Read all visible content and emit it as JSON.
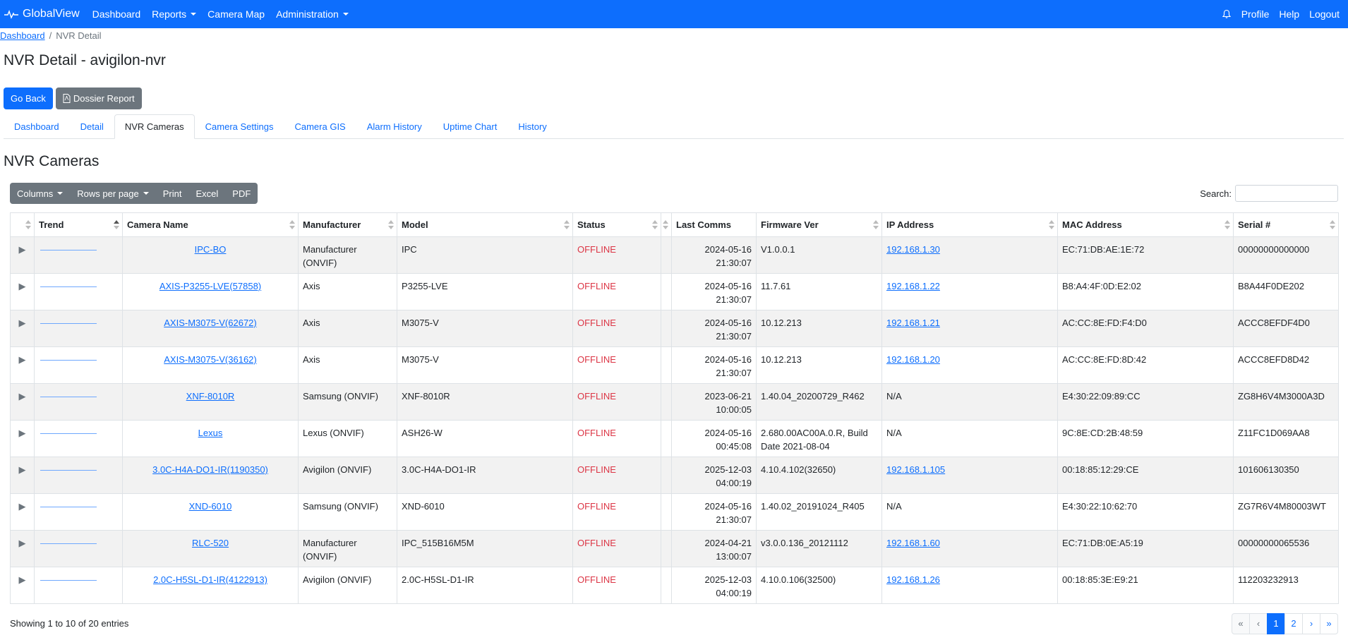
{
  "navbar": {
    "brand": "GlobalView",
    "left_items": [
      "Dashboard",
      "Reports",
      "Camera Map",
      "Administration"
    ],
    "right_items": [
      "Profile",
      "Help",
      "Logout"
    ]
  },
  "breadcrumb": {
    "home": "Dashboard",
    "separator": "/",
    "current": "NVR Detail"
  },
  "page_title": "NVR Detail - avigilon-nvr",
  "buttons": {
    "go_back": "Go Back",
    "dossier": "Dossier Report"
  },
  "tabs": [
    "Dashboard",
    "Detail",
    "NVR Cameras",
    "Camera Settings",
    "Camera GIS",
    "Alarm History",
    "Uptime Chart",
    "History"
  ],
  "active_tab": "NVR Cameras",
  "section_title": "NVR Cameras",
  "toolbar": {
    "columns": "Columns",
    "rows_per_page": "Rows per page",
    "print": "Print",
    "excel": "Excel",
    "pdf": "PDF",
    "search_label": "Search:",
    "search_value": ""
  },
  "table": {
    "headers": [
      "",
      "Trend",
      "Camera Name",
      "Manufacturer",
      "Model",
      "Status",
      "",
      "Last Comms",
      "Firmware Ver",
      "IP Address",
      "MAC Address",
      "Serial #"
    ],
    "rows": [
      {
        "camera": "IPC-BO",
        "manufacturer": "Manufacturer (ONVIF)",
        "model": "IPC",
        "status": "OFFLINE",
        "date": "2024-05-16",
        "time": "21:30:07",
        "firmware": "V1.0.0.1",
        "ip": "192.168.1.30",
        "ip_link": true,
        "mac": "EC:71:DB:AE:1E:72",
        "serial": "00000000000000"
      },
      {
        "camera": "AXIS-P3255-LVE(57858)",
        "manufacturer": "Axis",
        "model": "P3255-LVE",
        "status": "OFFLINE",
        "date": "2024-05-16",
        "time": "21:30:07",
        "firmware": "11.7.61",
        "ip": "192.168.1.22",
        "ip_link": true,
        "mac": "B8:A4:4F:0D:E2:02",
        "serial": "B8A44F0DE202"
      },
      {
        "camera": "AXIS-M3075-V(62672)",
        "manufacturer": "Axis",
        "model": "M3075-V",
        "status": "OFFLINE",
        "date": "2024-05-16",
        "time": "21:30:07",
        "firmware": "10.12.213",
        "ip": "192.168.1.21",
        "ip_link": true,
        "mac": "AC:CC:8E:FD:F4:D0",
        "serial": "ACCC8EFDF4D0"
      },
      {
        "camera": "AXIS-M3075-V(36162)",
        "manufacturer": "Axis",
        "model": "M3075-V",
        "status": "OFFLINE",
        "date": "2024-05-16",
        "time": "21:30:07",
        "firmware": "10.12.213",
        "ip": "192.168.1.20",
        "ip_link": true,
        "mac": "AC:CC:8E:FD:8D:42",
        "serial": "ACCC8EFD8D42"
      },
      {
        "camera": "XNF-8010R",
        "manufacturer": "Samsung (ONVIF)",
        "model": "XNF-8010R",
        "status": "OFFLINE",
        "date": "2023-06-21",
        "time": "10:00:05",
        "firmware": "1.40.04_20200729_R462",
        "ip": "N/A",
        "ip_link": false,
        "mac": "E4:30:22:09:89:CC",
        "serial": "ZG8H6V4M3000A3D"
      },
      {
        "camera": "Lexus",
        "manufacturer": "Lexus (ONVIF)",
        "model": "ASH26-W",
        "status": "OFFLINE",
        "date": "2024-05-16",
        "time": "00:45:08",
        "firmware": "2.680.00AC00A.0.R, Build Date 2021-08-04",
        "ip": "N/A",
        "ip_link": false,
        "mac": "9C:8E:CD:2B:48:59",
        "serial": "Z11FC1D069AA8"
      },
      {
        "camera": "3.0C-H4A-DO1-IR(1190350)",
        "manufacturer": "Avigilon (ONVIF)",
        "model": "3.0C-H4A-DO1-IR",
        "status": "OFFLINE",
        "date": "2025-12-03",
        "time": "04:00:19",
        "firmware": "4.10.4.102(32650)",
        "ip": "192.168.1.105",
        "ip_link": true,
        "mac": "00:18:85:12:29:CE",
        "serial": "101606130350"
      },
      {
        "camera": "XND-6010",
        "manufacturer": "Samsung (ONVIF)",
        "model": "XND-6010",
        "status": "OFFLINE",
        "date": "2024-05-16",
        "time": "21:30:07",
        "firmware": "1.40.02_20191024_R405",
        "ip": "N/A",
        "ip_link": false,
        "mac": "E4:30:22:10:62:70",
        "serial": "ZG7R6V4M80003WT"
      },
      {
        "camera": "RLC-520",
        "manufacturer": "Manufacturer (ONVIF)",
        "model": "IPC_515B16M5M",
        "status": "OFFLINE",
        "date": "2024-04-21",
        "time": "13:00:07",
        "firmware": "v3.0.0.136_20121112",
        "ip": "192.168.1.60",
        "ip_link": true,
        "mac": "EC:71:DB:0E:A5:19",
        "serial": "00000000065536"
      },
      {
        "camera": "2.0C-H5SL-D1-IR(4122913)",
        "manufacturer": "Avigilon (ONVIF)",
        "model": "2.0C-H5SL-D1-IR",
        "status": "OFFLINE",
        "date": "2025-12-03",
        "time": "04:00:19",
        "firmware": "4.10.0.106(32500)",
        "ip": "192.168.1.26",
        "ip_link": true,
        "mac": "00:18:85:3E:E9:21",
        "serial": "112203232913"
      }
    ]
  },
  "footer": {
    "entries": "Showing 1 to 10 of 20 entries",
    "pages": [
      "«",
      "‹",
      "1",
      "2",
      "›",
      "»"
    ],
    "active_page": "1"
  },
  "colors": {
    "primary": "#0d6efd",
    "secondary": "#6c757d",
    "offline": "#dc3545",
    "trend": "#6ea8fe"
  },
  "icons": {
    "brand": "pulse-icon",
    "notifications": "bell-icon",
    "dossier": "file-pdf-icon",
    "row_expand": "triangle-right-icon"
  }
}
